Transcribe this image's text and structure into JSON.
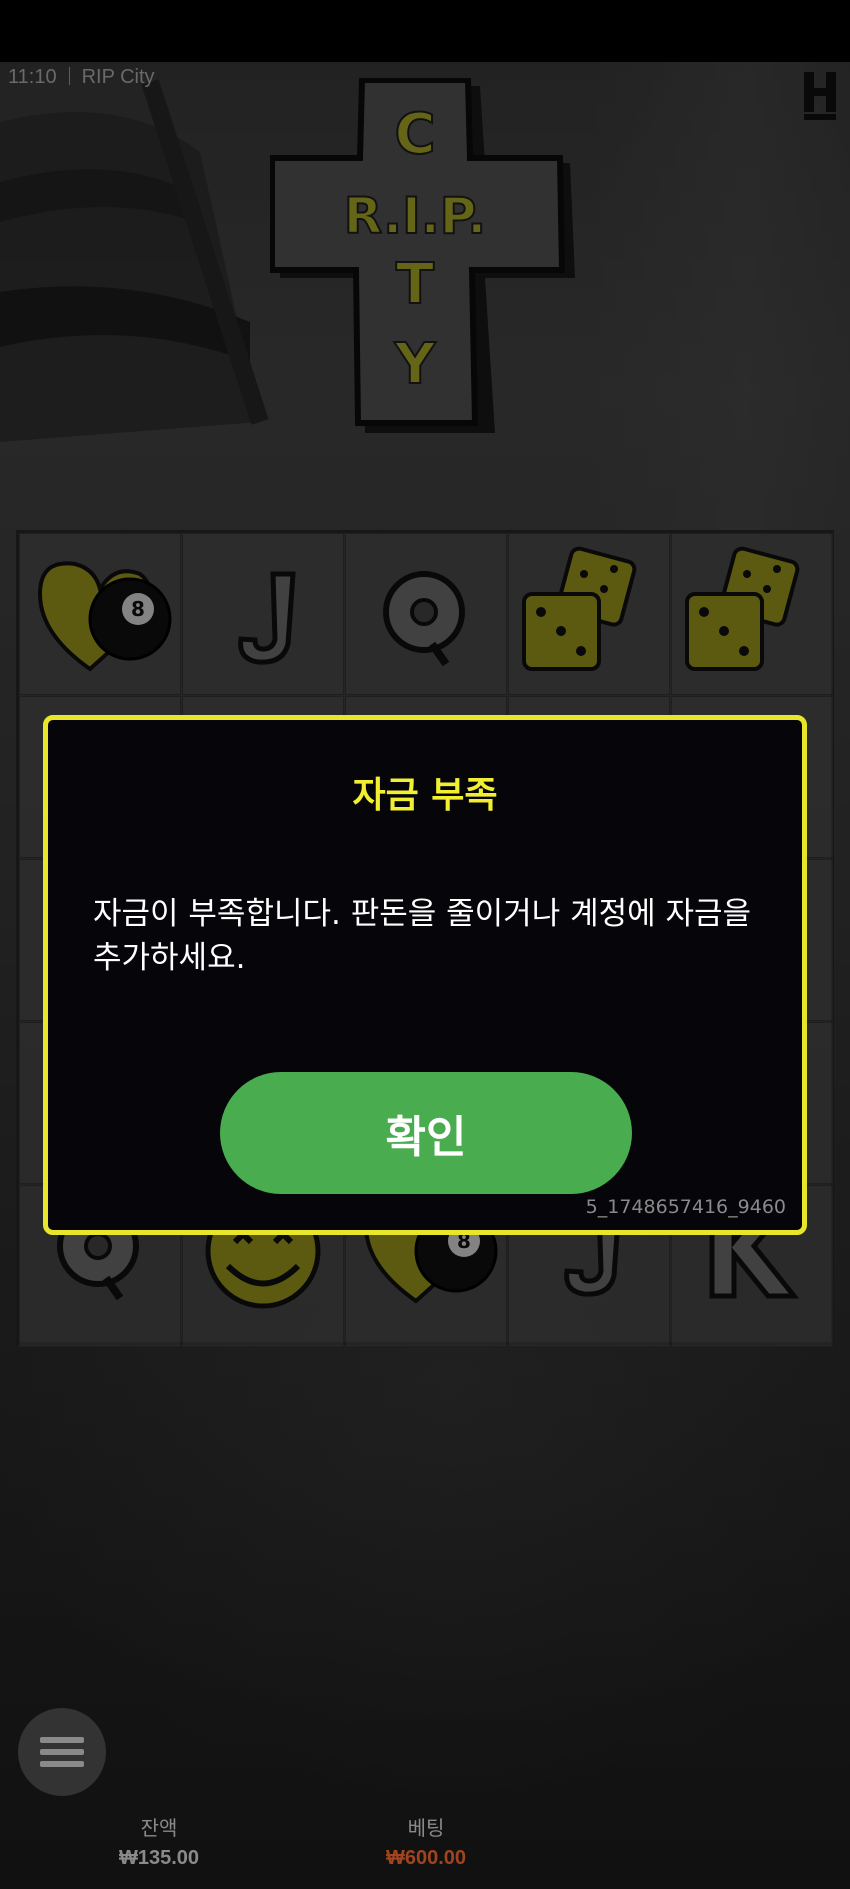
{
  "status_bar": {
    "time": "11:10",
    "game_name": "RIP City"
  },
  "logo": {
    "line1": "C",
    "line2": "R.I.P.",
    "line3": "T",
    "line4": "Y"
  },
  "reels": {
    "symbols_row1": [
      "heart-8ball",
      "J",
      "Q",
      "dice",
      "dice"
    ],
    "symbols_row5": [
      "Q",
      "skull-smiley",
      "heart-8ball",
      "J",
      "K"
    ]
  },
  "modal": {
    "title": "자금 부족",
    "message": "자금이 부족합니다. 판돈을 줄이거나 계정에 자금을 추가하세요.",
    "confirm_label": "확인",
    "code": "5_1748657416_9460"
  },
  "footer": {
    "balance_label": "잔액",
    "balance_value": "₩135.00",
    "bet_label": "베팅",
    "bet_value": "₩600.00"
  },
  "colors": {
    "accent_yellow": "#e7e62a",
    "confirm_green": "#49ac4f",
    "bet_orange": "#a0441f"
  }
}
